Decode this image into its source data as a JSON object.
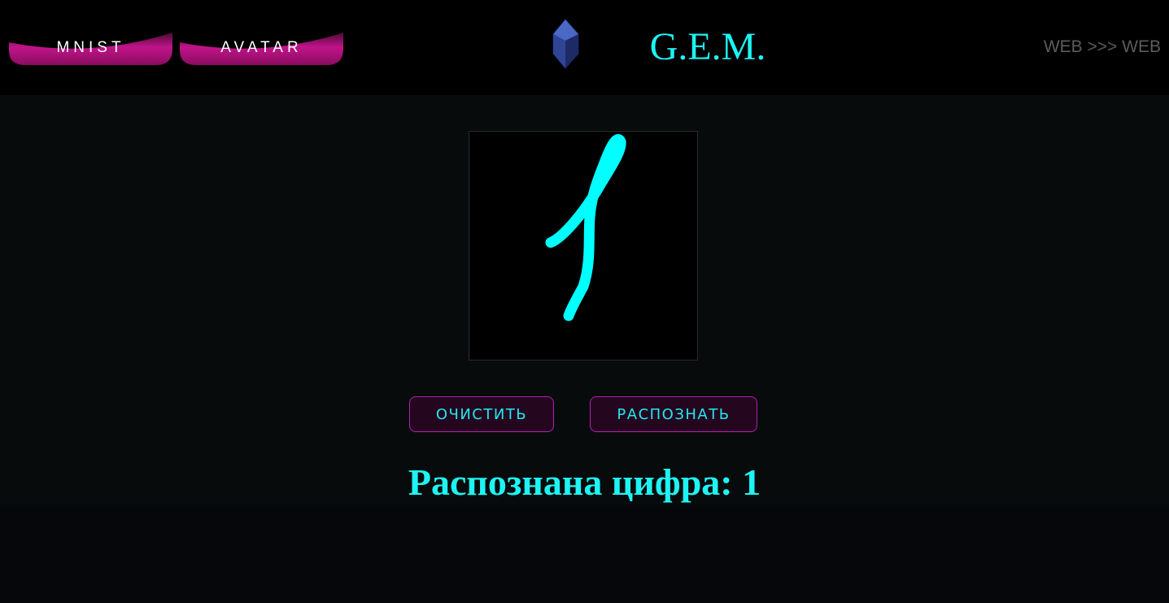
{
  "header": {
    "nav_tabs": [
      {
        "label": "MNIST"
      },
      {
        "label": "AVATAR"
      }
    ],
    "brand_title": "G.E.M.",
    "web_link": "WEB >>> WEB"
  },
  "canvas": {
    "drawn_digit": "1",
    "stroke_color": "#00ffff"
  },
  "actions": {
    "clear_label": "ОЧИСТИТЬ",
    "recognize_label": "РАСПОЗНАТЬ"
  },
  "result": {
    "text": "Распознана цифра: 1"
  },
  "colors": {
    "accent": "#1ef4f4",
    "tab_magenta": "#b0106e",
    "button_border": "#b21fb0",
    "button_bg": "#24071f"
  },
  "icons": {
    "logo": "gem-icon"
  }
}
